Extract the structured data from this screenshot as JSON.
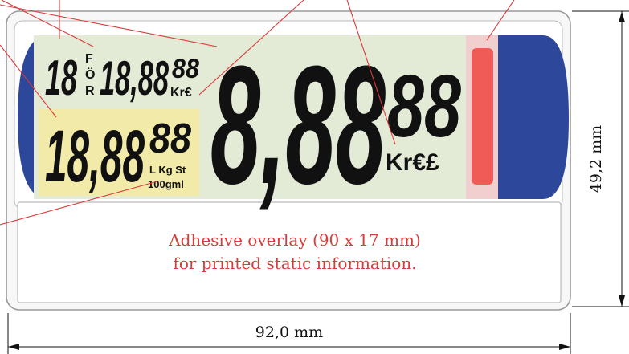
{
  "small_display": {
    "digits_left": "18",
    "stacked_labels": [
      "F",
      "Ö",
      "R"
    ],
    "digits_mid": "18,88",
    "digits_mid_small": "88",
    "currency": "Kr€"
  },
  "yellow_display": {
    "digits": "18,88",
    "digits_small": "88",
    "units_line1": "L Kg St",
    "units_line2": "100gml"
  },
  "main_display": {
    "digits": "8,88",
    "digits_small": "88",
    "currency": "Kr€£"
  },
  "overlay": {
    "line1": "Adhesive overlay (90 x 17 mm)",
    "line2": "for printed static information."
  },
  "dimensions": {
    "height_label": "49,2 mm",
    "width_label": "92,0 mm"
  },
  "colors": {
    "frame_blue": "#2d479a",
    "lcd_green": "#e3ead6",
    "lcd_yellow": "#f2eaa8",
    "indicator_red": "#f05a57",
    "indicator_pink": "#f1cfcf",
    "annotation_red": "#d93b3b"
  }
}
